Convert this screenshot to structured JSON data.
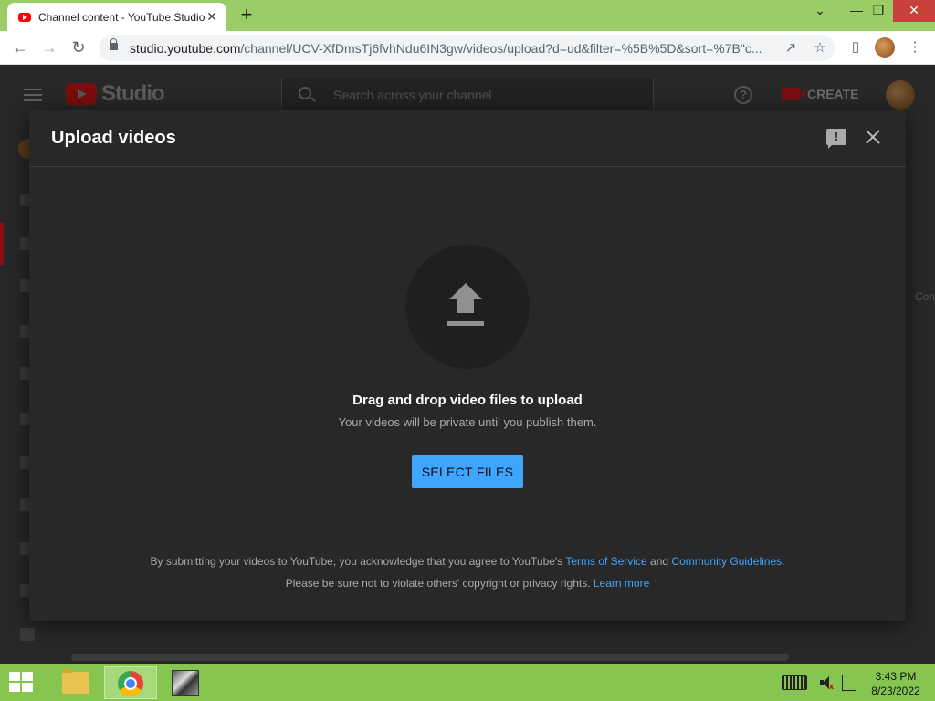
{
  "browser": {
    "tab_title": "Channel content - YouTube Studio",
    "tab_close": "✕",
    "new_tab": "+",
    "url_domain": "studio.youtube.com",
    "url_path": "/channel/UCV-XfDmsTj6fvhNdu6IN3gw/videos/upload?d=ud&filter=%5B%5D&sort=%7B\"c...",
    "window_controls": [
      "⌄",
      "—",
      "❐",
      "✕"
    ]
  },
  "studio": {
    "logo_text": "Studio",
    "search_placeholder": "Search across your channel",
    "help": "?",
    "create_label": "CREATE",
    "right_ghost": "Con"
  },
  "modal": {
    "title": "Upload videos",
    "drag_title": "Drag and drop video files to upload",
    "drag_subtitle": "Your videos will be private until you publish them.",
    "select_button": "SELECT FILES",
    "legal_line1_pre": "By submitting your videos to YouTube, you acknowledge that you agree to YouTube's ",
    "legal_terms_link": "Terms of Service",
    "legal_and": " and ",
    "legal_guidelines_link": "Community Guidelines",
    "legal_line1_end": ".",
    "legal_line2_pre": "Please be sure not to violate others' copyright or privacy rights. ",
    "legal_learn_more": "Learn more"
  },
  "taskbar": {
    "time": "3:43 PM",
    "date": "8/23/2022"
  },
  "colors": {
    "accent_blue": "#3ea6ff",
    "modal_bg": "#282828",
    "taskbar_green": "#86c54f",
    "titlebar_green": "#9bcd67"
  }
}
